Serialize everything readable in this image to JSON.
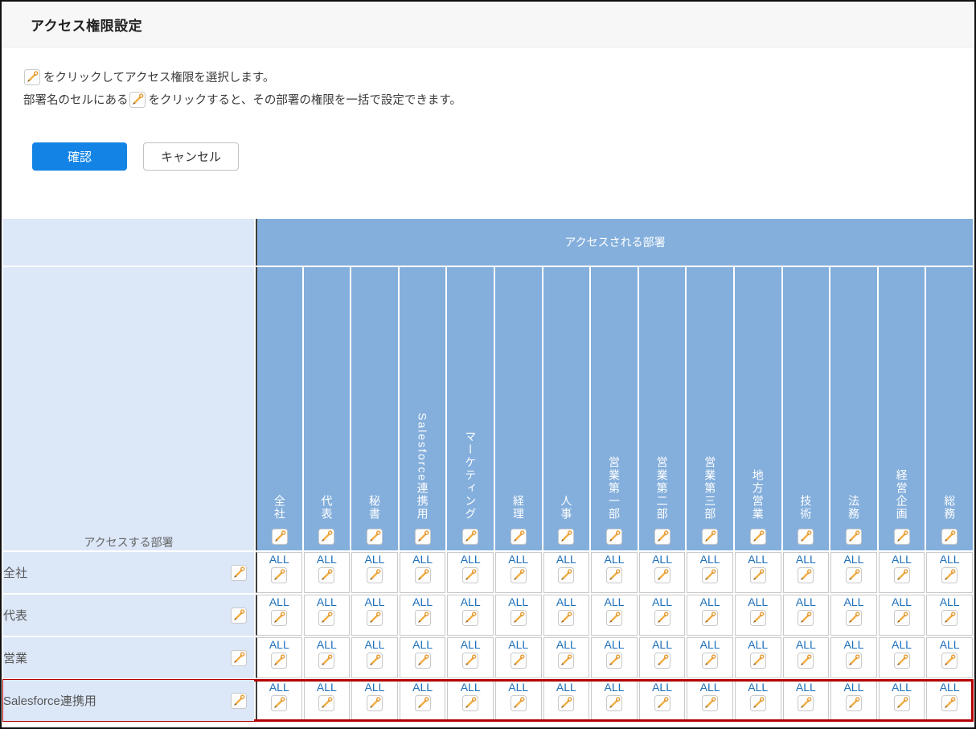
{
  "page": {
    "title": "アクセス権限設定",
    "instructions": {
      "line1_suffix": "をクリックしてアクセス権限を選択します。",
      "line2_prefix": "部署名のセルにある",
      "line2_suffix": "をクリックすると、その部署の権限を一括で設定できます。"
    },
    "buttons": {
      "confirm": "確認",
      "cancel": "キャンセル"
    }
  },
  "table": {
    "col_group_header": "アクセスされる部署",
    "row_group_header": "アクセスする部署",
    "columns": [
      "全社",
      "代表",
      "秘書",
      "Salesforce連携用",
      "マーケティング",
      "経理",
      "人事",
      "営業第一部",
      "営業第二部",
      "営業第三部",
      "地方営業",
      "技術",
      "法務",
      "経営企画",
      "総務"
    ],
    "rows": [
      {
        "label": "全社",
        "highlighted": false,
        "values": [
          "ALL",
          "ALL",
          "ALL",
          "ALL",
          "ALL",
          "ALL",
          "ALL",
          "ALL",
          "ALL",
          "ALL",
          "ALL",
          "ALL",
          "ALL",
          "ALL",
          "ALL"
        ]
      },
      {
        "label": "代表",
        "highlighted": false,
        "values": [
          "ALL",
          "ALL",
          "ALL",
          "ALL",
          "ALL",
          "ALL",
          "ALL",
          "ALL",
          "ALL",
          "ALL",
          "ALL",
          "ALL",
          "ALL",
          "ALL",
          "ALL"
        ]
      },
      {
        "label": "営業",
        "highlighted": false,
        "values": [
          "ALL",
          "ALL",
          "ALL",
          "ALL",
          "ALL",
          "ALL",
          "ALL",
          "ALL",
          "ALL",
          "ALL",
          "ALL",
          "ALL",
          "ALL",
          "ALL",
          "ALL"
        ]
      },
      {
        "label": "Salesforce連携用",
        "highlighted": true,
        "values": [
          "ALL",
          "ALL",
          "ALL",
          "ALL",
          "ALL",
          "ALL",
          "ALL",
          "ALL",
          "ALL",
          "ALL",
          "ALL",
          "ALL",
          "ALL",
          "ALL",
          "ALL"
        ]
      }
    ]
  },
  "icons": {
    "pencil": "pencil-icon"
  },
  "colors": {
    "header_blue": "#84afdc",
    "light_blue": "#dce7f8",
    "link_blue": "#1b6fbb",
    "highlight_red": "#b40000",
    "confirm_button_blue": "#1384e5",
    "title_bar_gray": "#f7f7f8"
  }
}
